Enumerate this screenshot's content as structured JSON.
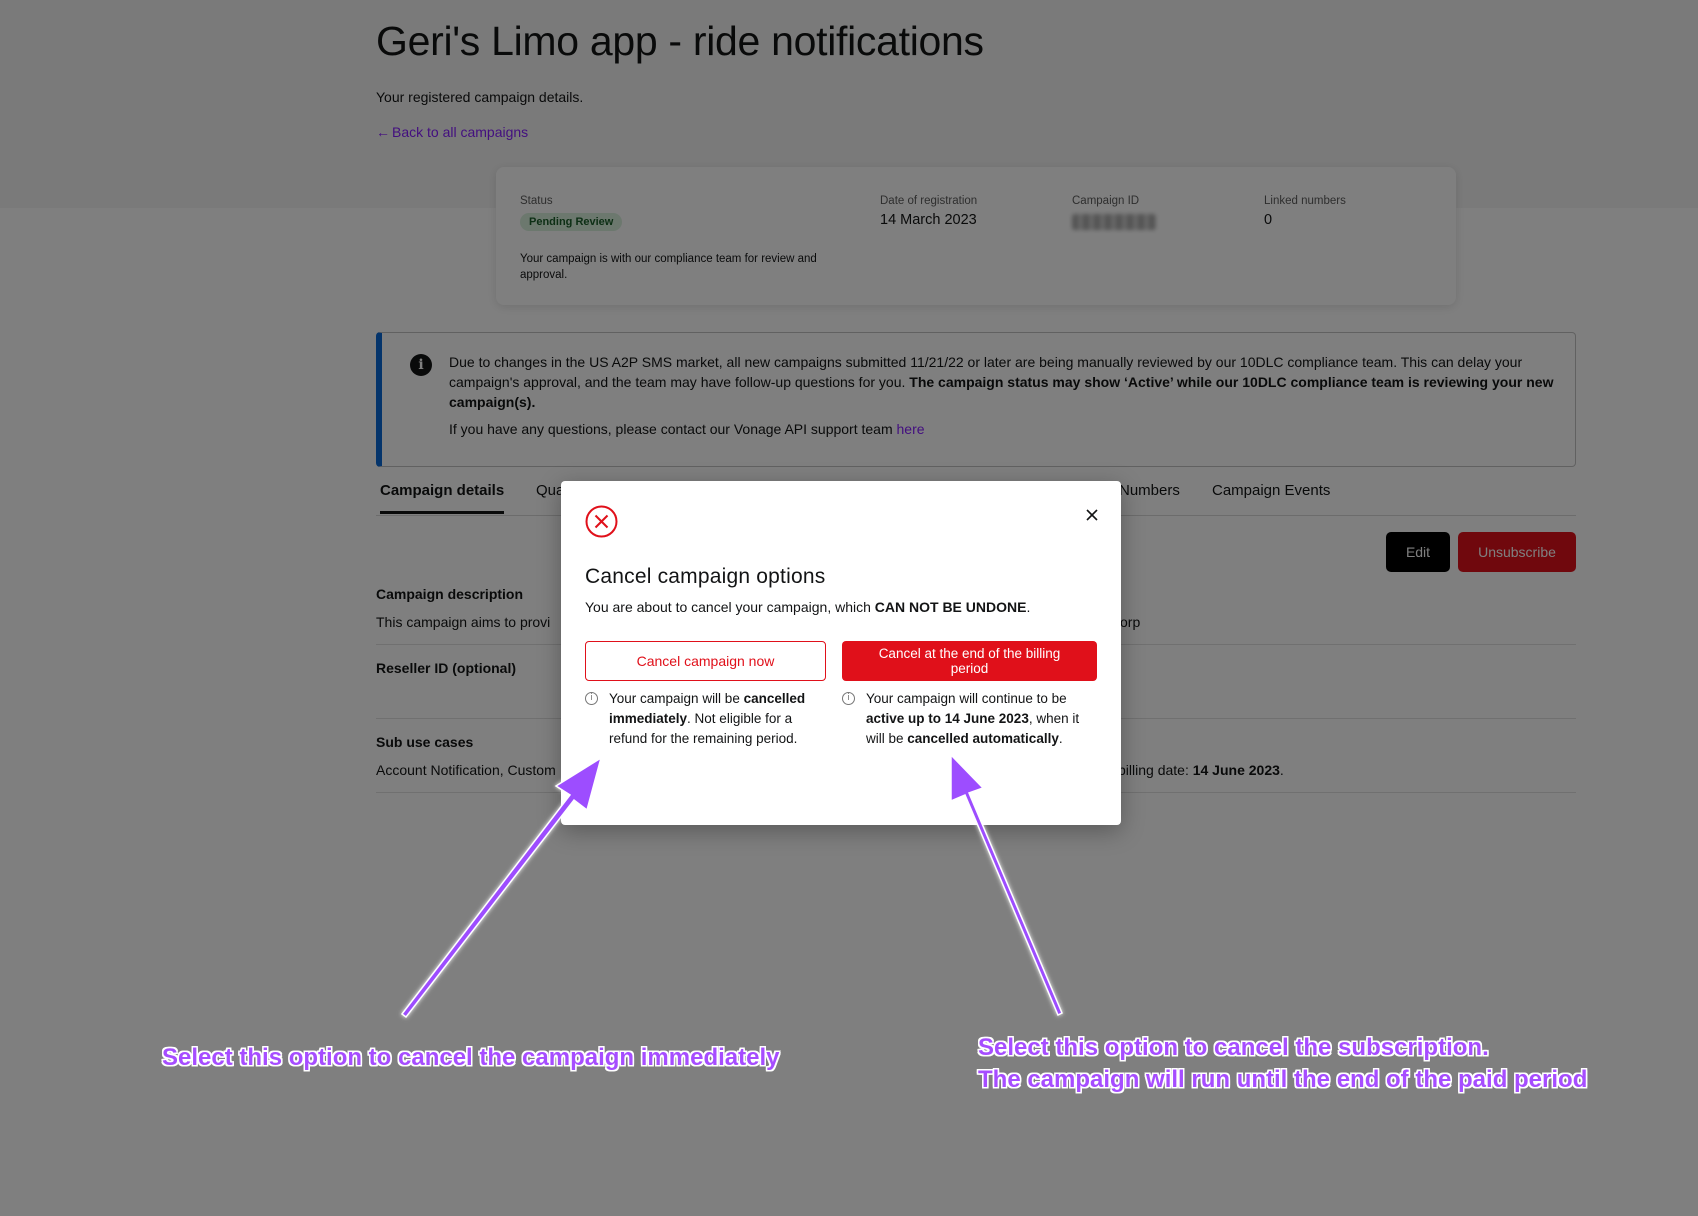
{
  "page": {
    "title": "Geri's Limo app - ride notifications",
    "subtitle": "Your registered campaign details.",
    "back_link": "Back to all campaigns"
  },
  "summary": {
    "status_label": "Status",
    "status_badge": "Pending Review",
    "status_note": "Your campaign is with our compliance team for review and approval.",
    "date_label": "Date of registration",
    "date_value": "14 March 2023",
    "campaign_id_label": "Campaign ID",
    "linked_label": "Linked numbers",
    "linked_value": "0"
  },
  "banner": {
    "text_regular": "Due to changes in the US A2P SMS market, all new campaigns submitted 11/21/22 or later are being manually reviewed by our 10DLC compliance team. This can delay your campaign's approval, and the team may have follow-up questions for you. ",
    "text_bold": "The campaign status may show ‘Active’ while our 10DLC compliance team is reviewing your new campaign(s).",
    "contact_text": "If you have any questions, please contact our Vonage API support team ",
    "contact_link": "here"
  },
  "tabs": [
    {
      "label": "Campaign details",
      "active": true
    },
    {
      "label": "Qua"
    },
    {
      "label": "Numbers"
    },
    {
      "label": "Campaign Events"
    }
  ],
  "actions": {
    "edit": "Edit",
    "unsubscribe": "Unsubscribe"
  },
  "details": {
    "description_label": "Campaign description",
    "description_value": "This campaign aims to provi",
    "description_right": "orp",
    "reseller_label": "Reseller ID (optional)",
    "sub_use_label": "Sub use cases",
    "sub_use_value": "Account Notification, Custom",
    "billing_prefix": "billing date: ",
    "billing_date": "14 June 2023",
    "billing_suffix": "."
  },
  "modal": {
    "title": "Cancel campaign options",
    "desc_regular": "You are about to cancel your campaign, which ",
    "desc_bold": "CAN NOT BE UNDONE",
    "desc_end": ".",
    "btn_now": "Cancel campaign now",
    "btn_end": "Cancel at the end of the billing period",
    "note_now": {
      "p1": "Your campaign will be ",
      "b1": "cancelled immediately",
      "p2": ". Not eligible for a refund for the remaining period."
    },
    "note_end": {
      "p1": "Your campaign will continue to be ",
      "b1": "active up to 14 June 2023",
      "p2": ", when it will be ",
      "b2": "cancelled automatically",
      "p3": "."
    }
  },
  "annotations": {
    "left": "Select this option to cancel the campaign immediately",
    "right_line1": "Select this option to cancel the subscription.",
    "right_line2": "The campaign will run until the end of the paid period"
  },
  "colors": {
    "accent_purple": "#871fff",
    "danger_red": "#e0101a",
    "info_blue": "#0968d6",
    "annotation_purple": "#a64dff",
    "badge_green": "#d8f0dc"
  }
}
